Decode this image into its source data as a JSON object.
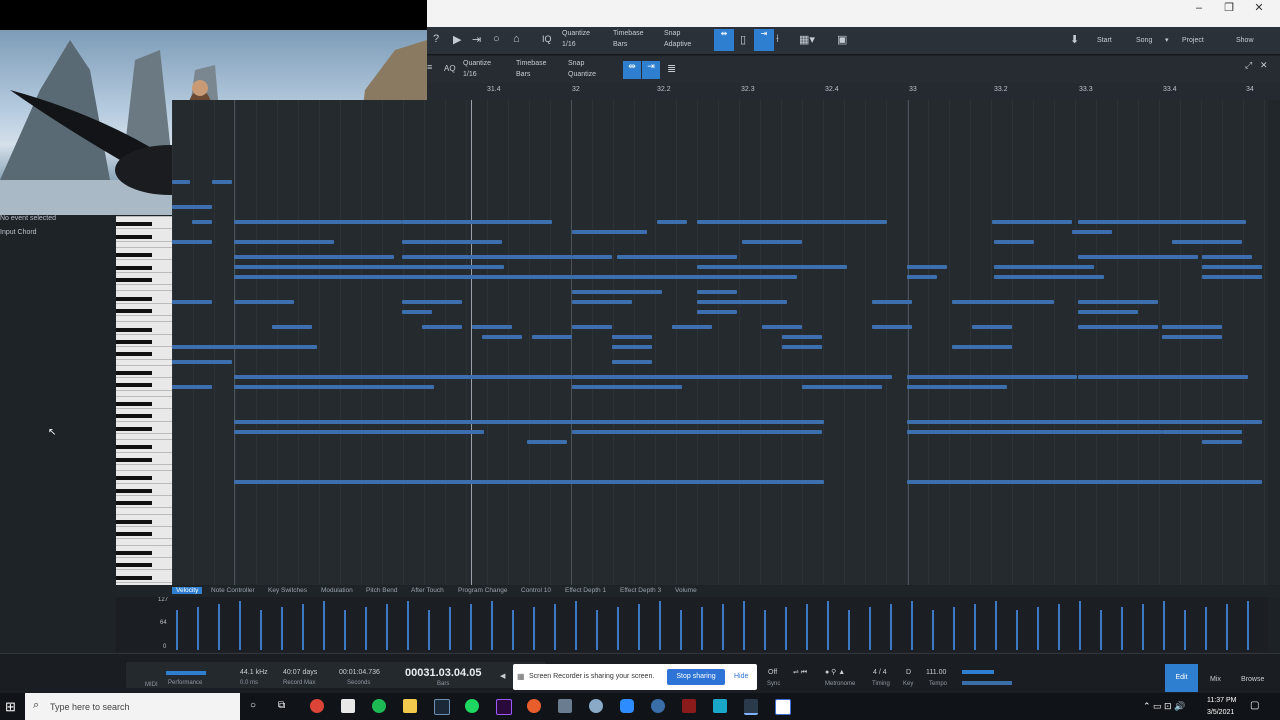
{
  "window": {
    "controls": [
      "–",
      "❐",
      "✕"
    ]
  },
  "toolbar": {
    "quantize_label": "Quantize",
    "quantize_value": "1/16",
    "timebase_label": "Timebase",
    "timebase_value": "Bars",
    "snap_label": "Snap",
    "snap_value": "Adaptive",
    "start": "Start",
    "song": "Song",
    "project": "Project",
    "show": "Show"
  },
  "editor": {
    "quantize_label": "Quantize",
    "quantize_value": "1/16",
    "timebase_label": "Timebase",
    "timebase_value": "Bars",
    "snap_label": "Snap",
    "snap_value": "Quantize"
  },
  "ruler": [
    "31.4",
    "32",
    "32.2",
    "32.3",
    "32.4",
    "33",
    "33.2",
    "33.3",
    "33.4",
    "34"
  ],
  "inspector": {
    "no_event": "No event selected",
    "input_chord": "Input Chord"
  },
  "lanes": [
    "Velocity",
    "Note Controller",
    "Key Switches",
    "Modulation",
    "Pitch Bend",
    "After Touch",
    "Program Change",
    "Control 10",
    "Effect Depth 1",
    "Effect Depth 3",
    "Volume"
  ],
  "velocity_scale": [
    "127",
    "64",
    "0"
  ],
  "transport": {
    "midi": "MIDI",
    "performance": "Performance",
    "sample_rate": "44.1 kHz",
    "latency": "0.0 ms",
    "record_max": "40:07 days",
    "record_max_label": "Record Max",
    "seconds": "00:01:04.736",
    "seconds_label": "Seconds",
    "bars": "00031.03.04.05",
    "bars_label": "Bars",
    "sync_off": "Off",
    "sync": "Sync",
    "metronome": "Metronome",
    "timing": "4 / 4",
    "timing_label": "Timing",
    "key": "D",
    "key_label": "Key",
    "tempo": "111.00",
    "tempo_label": "Tempo",
    "edit": "Edit",
    "mix": "Mix",
    "browse": "Browse"
  },
  "share": {
    "message": "Screen Recorder is sharing your screen.",
    "stop": "Stop sharing",
    "hide": "Hide"
  },
  "taskbar": {
    "search_placeholder": "Type here to search",
    "time": "11:37 PM",
    "date": "3/5/2021"
  }
}
